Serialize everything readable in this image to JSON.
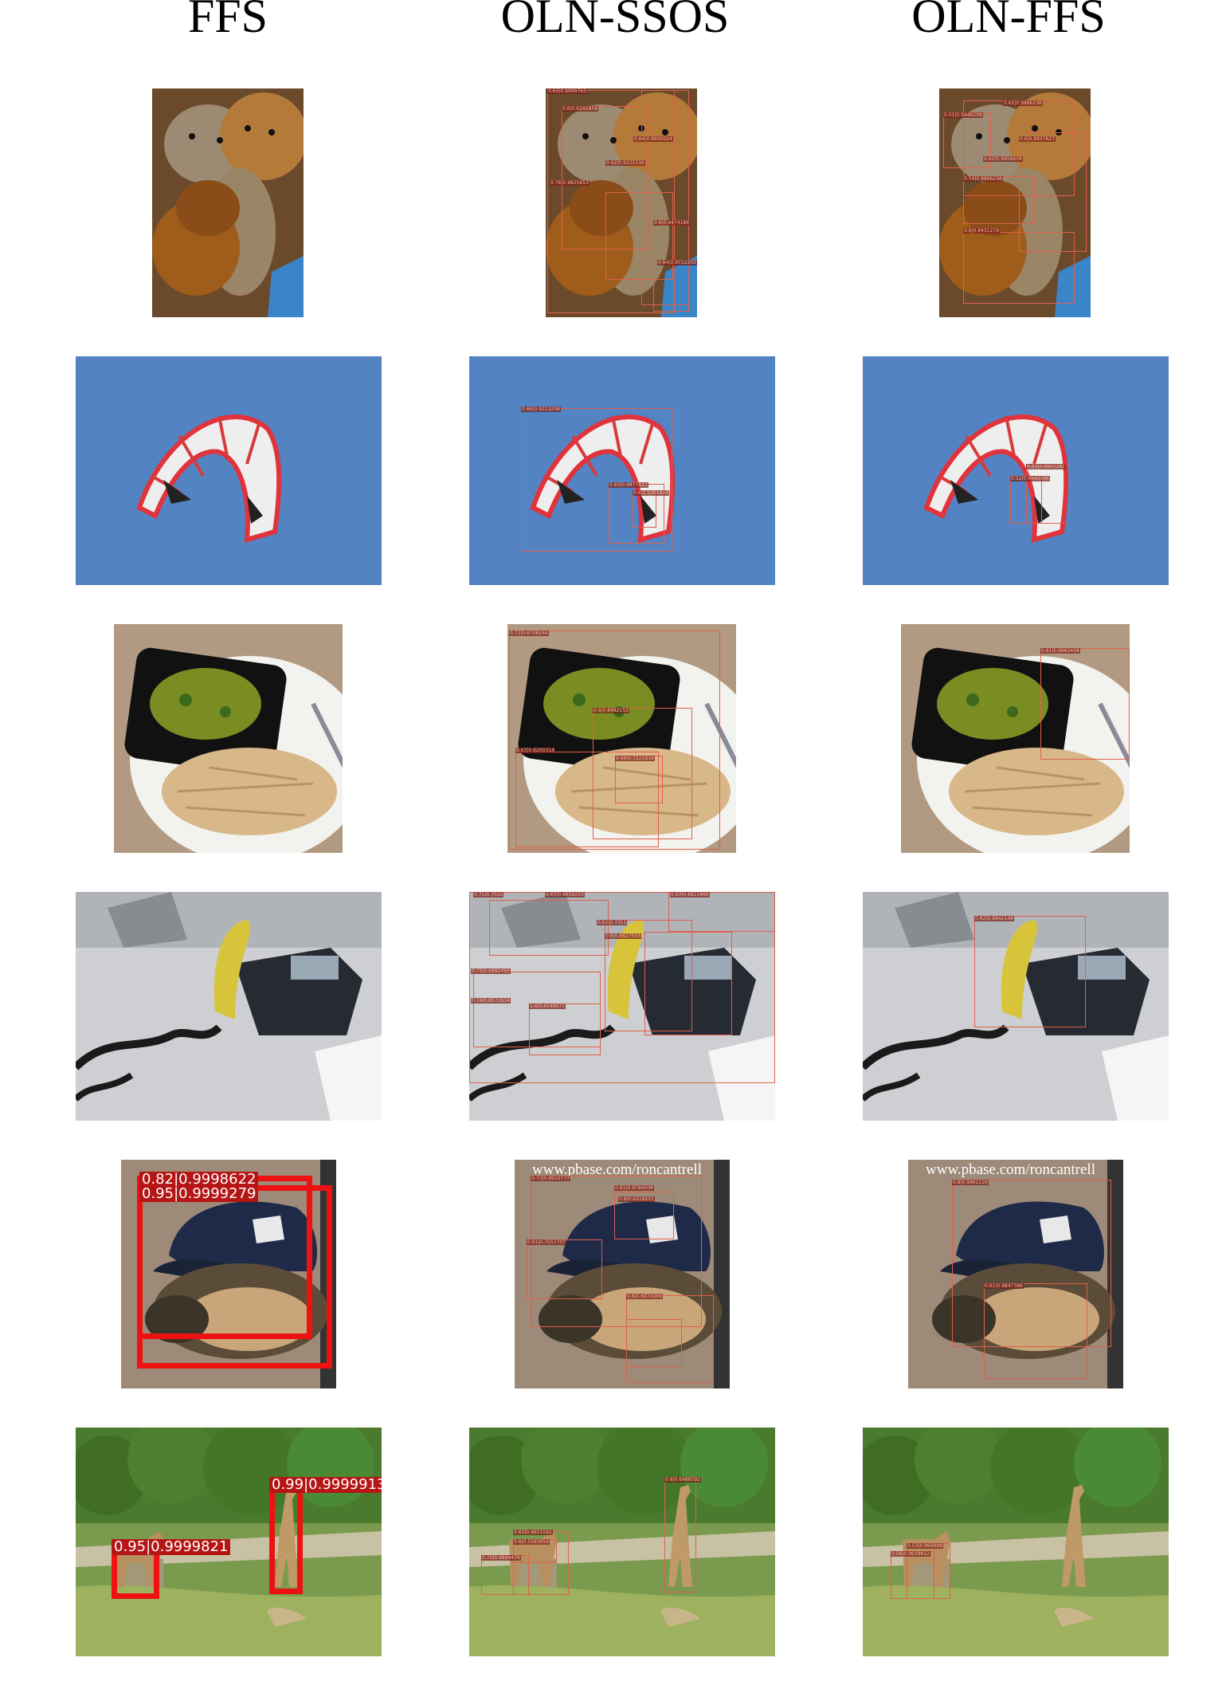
{
  "columns": [
    "FFS",
    "OLN-SSOS",
    "OLN-FFS"
  ],
  "rows": [
    {
      "subject": "teddy bears",
      "ssos_tags": [
        "0.63|0.9999763",
        "0.6|0.6291858",
        "0.64|0.9990024",
        "0.62|0.9225536",
        "0.76|0.9825853",
        "0.6|0.9474186",
        "0.64|0.9552203"
      ],
      "ffs_oln_tags": [
        "0.62|0.9966238",
        "0.51|0.9446208",
        "0.6|0.9937627",
        "0.62|0.9958609",
        "0.54|0.9966238",
        "0.6|0.9431279"
      ]
    },
    {
      "subject": "kite",
      "ssos_tags": [
        "0.66|0.9213208",
        "0.63|0.9877823",
        "0.6|0.9361924"
      ],
      "ffs_oln_tags": [
        "0.63|0.9903381",
        "0.52|0.9943346"
      ]
    },
    {
      "subject": "food tray",
      "ssos_tags": [
        "0.72|0.6708244",
        "0.6|0.8482153",
        "0.63|0.6200314",
        "0.66|0.7221816"
      ],
      "ffs_oln_tags": [
        "0.61|0.9963458"
      ]
    },
    {
      "subject": "phone and banana",
      "ssos_tags": [
        "0.71|0.7022",
        "0.63|0.6659253",
        "0.63|0.6815866",
        "0.62|0.7311",
        "0.6|0.6827556",
        "0.73|0.6982495",
        "0.74|0.6571634",
        "0.6|0.6549077"
      ],
      "ffs_oln_tags": [
        "0.62|0.9942148"
      ]
    },
    {
      "subject": "cap and glove",
      "ffs_tags": [
        "0.82|0.9998622",
        "0.95|0.9999279"
      ],
      "watermark": "www.pbase.com/roncantrell",
      "ssos_tags": [
        "0.73|0.9910773",
        "0.61|0.9784508",
        "0.6|0.6218201",
        "0.61|0.7557707",
        "0.6|0.6074369"
      ],
      "ffs_oln_tags": [
        "0.8|0.9961126",
        "0.61|0.9847386"
      ]
    },
    {
      "subject": "giraffes",
      "ffs_tags": [
        "0.99|0.9999913",
        "0.95|0.9999821"
      ],
      "ssos_tags": [
        "0.6|0.6486592",
        "0.63|0.6651591",
        "0.6|0.5593959",
        "0.73|0.9894439"
      ],
      "ffs_oln_tags": [
        "0.53|0.969998",
        "0.56|0.9939812"
      ]
    }
  ]
}
